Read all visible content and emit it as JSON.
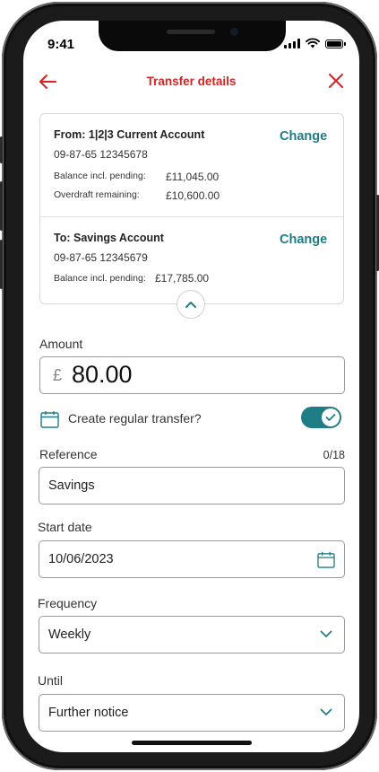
{
  "status": {
    "time": "9:41"
  },
  "header": {
    "title": "Transfer details"
  },
  "from_account": {
    "title": "From: 1|2|3 Current Account",
    "sort_and_number": "09-87-65   12345678",
    "balance_label": "Balance incl. pending:",
    "balance_value": "£11,045.00",
    "overdraft_label": "Overdraft remaining:",
    "overdraft_value": "£10,600.00",
    "change_label": "Change"
  },
  "to_account": {
    "title": "To: Savings Account",
    "sort_and_number": "09-87-65   12345679",
    "balance_label": "Balance incl. pending:",
    "balance_value": "£17,785.00",
    "change_label": "Change"
  },
  "amount": {
    "label": "Amount",
    "currency": "£",
    "value": "80.00"
  },
  "regular_transfer": {
    "label": "Create regular transfer?",
    "enabled": true
  },
  "reference": {
    "label": "Reference",
    "counter": "0/18",
    "value": "Savings"
  },
  "start_date": {
    "label": "Start date",
    "value": "10/06/2023"
  },
  "frequency": {
    "label": "Frequency",
    "value": "Weekly"
  },
  "until": {
    "label": "Until",
    "value": "Further notice"
  },
  "colors": {
    "brand_red": "#d42424",
    "accent_teal": "#1f7d86"
  },
  "icons": [
    "back-arrow-icon",
    "close-icon",
    "chevron-up-icon",
    "calendar-icon",
    "check-icon",
    "chevron-down-icon"
  ]
}
